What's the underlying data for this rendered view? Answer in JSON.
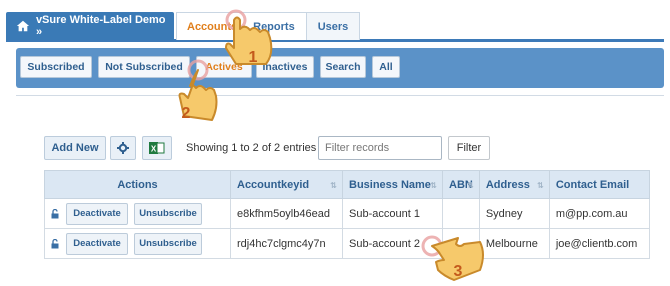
{
  "nav": {
    "brand": "vSure White-Label Demo »",
    "tabs": [
      {
        "label": "Accounts",
        "active": true
      },
      {
        "label": "Reports"
      },
      {
        "label": "Users"
      }
    ]
  },
  "filters": [
    "Subscribed",
    "Not Subscribed",
    "Actives",
    "Inactives",
    "Search",
    "All"
  ],
  "toolbar": {
    "add_new": "Add New",
    "settings_icon": "gear-icon",
    "excel_icon": "excel-icon",
    "entries_info": "Showing 1 to 2 of 2 entries",
    "filter_placeholder": "Filter records",
    "filter_button": "Filter"
  },
  "table": {
    "headers": [
      "Actions",
      "Accountkeyid",
      "Business Name",
      "ABN",
      "Address",
      "Contact Email"
    ],
    "rows": [
      {
        "deactivate": "Deactivate",
        "unsubscribe": "Unsubscribe",
        "accountkeyid": "e8kfhm5oylb46ead",
        "business_name": "Sub-account 1",
        "abn": "",
        "address": "Sydney",
        "email": "m@pp.com.au"
      },
      {
        "deactivate": "Deactivate",
        "unsubscribe": "Unsubscribe",
        "accountkeyid": "rdj4hc7clgmc4y7n",
        "business_name": "Sub-account 2",
        "abn": "",
        "address": "Melbourne",
        "email": "joe@clientb.com"
      }
    ]
  },
  "annotations": [
    "1",
    "2",
    "3"
  ],
  "colors": {
    "nav_blue": "#3a7ab6",
    "filter_bar": "#5b92c8",
    "active_tab": "#e07f1c",
    "header_bg": "#dbe7f3"
  }
}
